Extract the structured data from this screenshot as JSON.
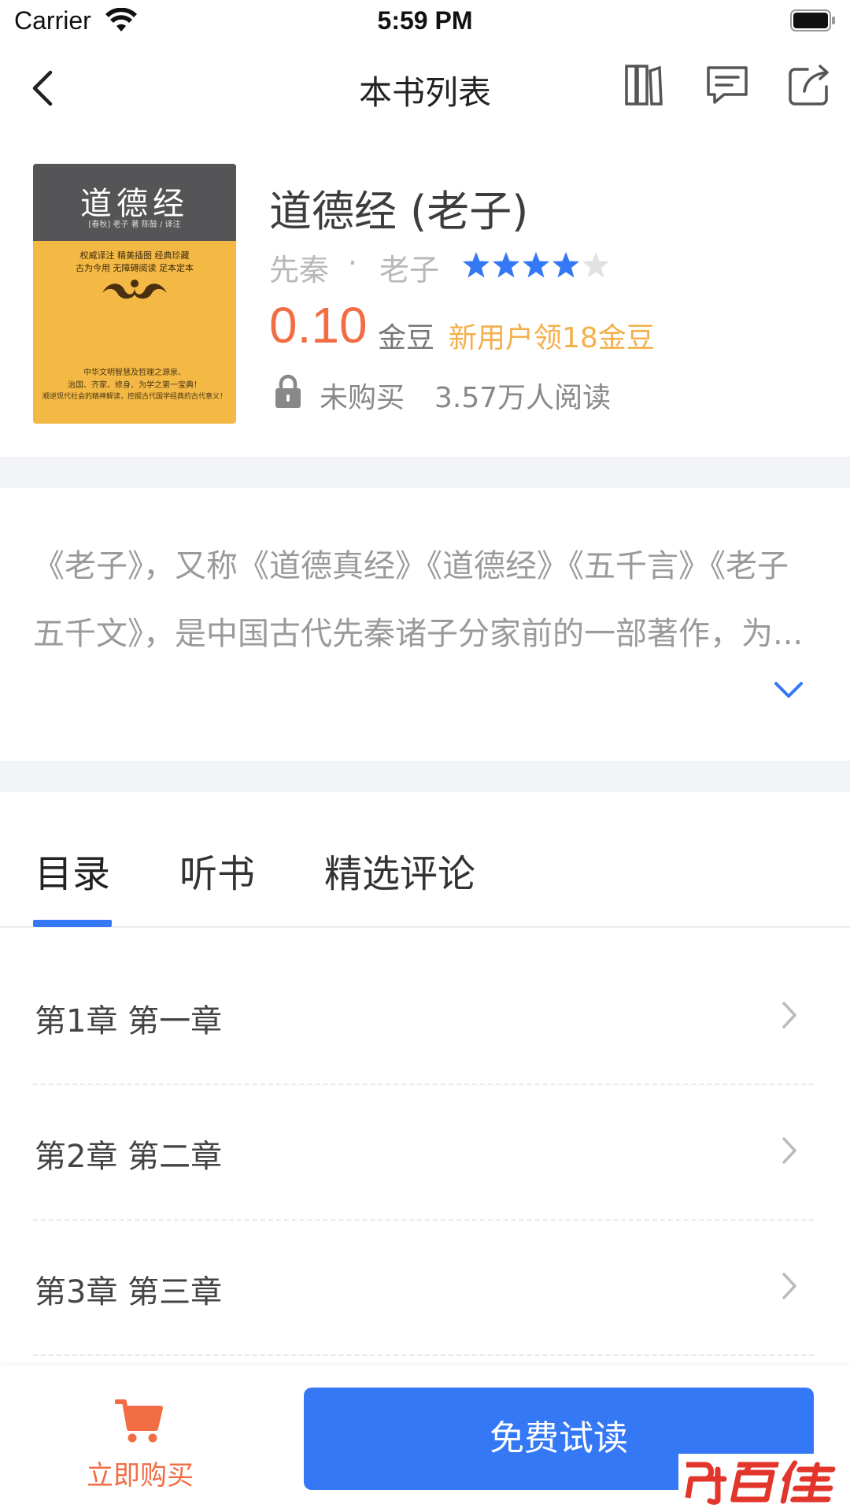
{
  "status_bar": {
    "carrier": "Carrier",
    "time": "5:59 PM"
  },
  "nav": {
    "title": "本书列表",
    "icons": [
      "back-icon",
      "bookshelf-icon",
      "comment-icon",
      "share-icon"
    ]
  },
  "book": {
    "cover": {
      "title": "道德经",
      "subtitle": "[春秋] 老子 著  陈鼓 / 译注",
      "line1": "权威译注  精美插图  经典珍藏",
      "line2": "古为今用  无障碍阅读  足本定本",
      "bottom1": "中华文明智慧及哲理之源泉、",
      "bottom2": "治国、齐家、修身、为学之第一宝典！",
      "bottom3": "顺逆现代社会的精神解读，挖掘古代国学经典的古代意义！"
    },
    "title": "道德经 (老子)",
    "dynasty": "先秦",
    "separator": "·",
    "author": "老子",
    "rating": 4.5,
    "price": "0.10",
    "price_unit": "金豆",
    "promo": "新用户领18金豆",
    "purchase_status": "未购买",
    "read_count": "3.57万人阅读"
  },
  "description": "《老子》，又称《道德真经》《道德经》《五千言》《老子五千文》，是中国古代先秦诸子分家前的一部著作，为...",
  "tabs": [
    {
      "label": "目录",
      "active": true
    },
    {
      "label": "听书",
      "active": false
    },
    {
      "label": "精选评论",
      "active": false
    }
  ],
  "chapters": [
    {
      "label": "第1章 第一章"
    },
    {
      "label": "第2章 第二章"
    },
    {
      "label": "第3章 第三章"
    }
  ],
  "bottom": {
    "buy_label": "立即购买",
    "trial_label": "免费试读"
  },
  "watermark": {
    "logo_text": "百佳"
  },
  "colors": {
    "accent": "#3478f6",
    "price": "#f26d43",
    "promo": "#f3b04b",
    "separator": "#f2f4f7"
  }
}
